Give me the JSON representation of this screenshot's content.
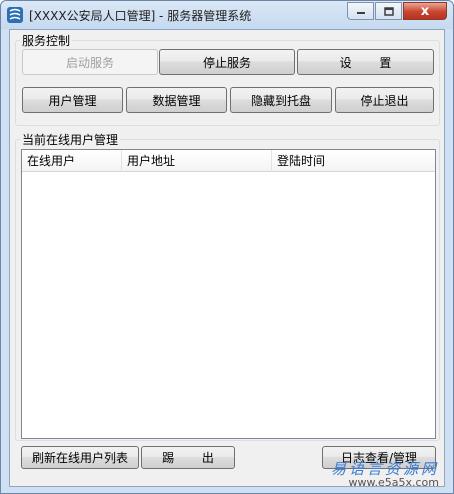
{
  "window": {
    "title": "[XXXX公安局人口管理] - 服务器管理系统",
    "icon": "app-logo-icon",
    "controls": {
      "minimize": "minimize-icon",
      "maximize": "maximize-icon",
      "close": "close-icon",
      "close_glyph": "x"
    }
  },
  "service_group": {
    "label": "服务控制",
    "buttons": {
      "start": "启动服务",
      "stop": "停止服务",
      "settings": "设 置",
      "user_mgmt": "用户管理",
      "data_mgmt": "数据管理",
      "hide_tray": "隐藏到托盘",
      "stop_exit": "停止退出"
    }
  },
  "online_group": {
    "label": "当前在线用户管理",
    "columns": [
      "在线用户",
      "用户地址",
      "登陆时间"
    ],
    "rows": []
  },
  "bottom_buttons": {
    "refresh": "刷新在线用户列表",
    "kick": "踢 出",
    "log": "日志查看/管理"
  },
  "watermark": {
    "cn": "易语言资源网",
    "url": "www.e5a5x.com"
  },
  "colors": {
    "title_bar": "#c5d9ef",
    "close_button": "#c8452f",
    "watermark_text": "#3a7bd5"
  }
}
